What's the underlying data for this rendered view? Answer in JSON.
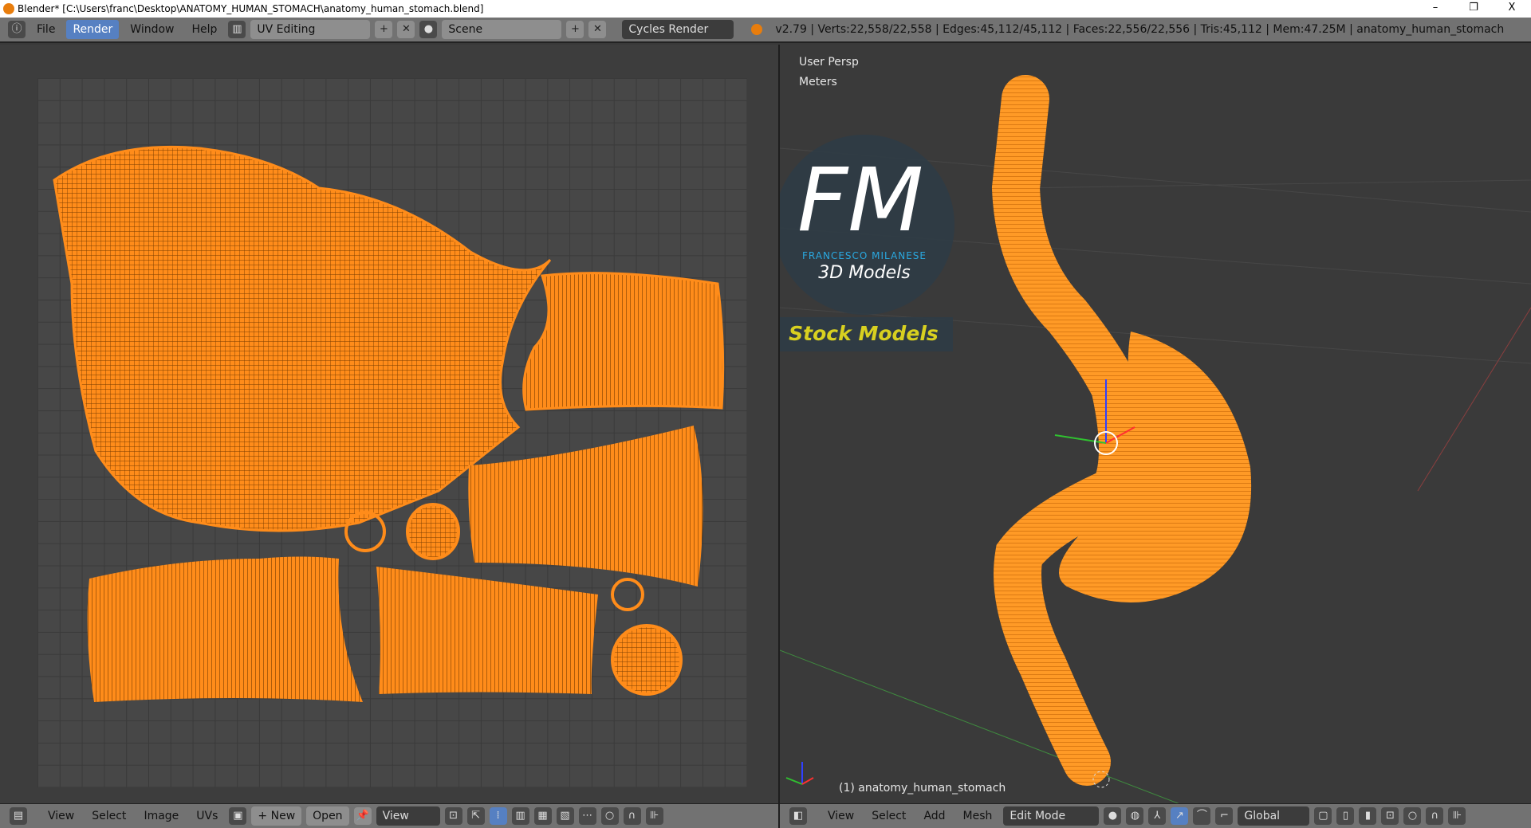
{
  "window": {
    "title": "Blender* [C:\\Users\\franc\\Desktop\\ANATOMY_HUMAN_STOMACH\\anatomy_human_stomach.blend]",
    "minimize": "–",
    "restore": "❐",
    "close": "X"
  },
  "top": {
    "menus": [
      "File",
      "Render",
      "Window",
      "Help"
    ],
    "active_menu": "Render",
    "layout": "UV Editing",
    "scene": "Scene",
    "engine": "Cycles Render",
    "stats": "v2.79 | Verts:22,558/22,558 | Edges:45,112/45,112 | Faces:22,556/22,556 | Tris:45,112 | Mem:47.25M | anatomy_human_stomach"
  },
  "viewport": {
    "view_name": "User Persp",
    "units": "Meters",
    "object_label": "(1) anatomy_human_stomach"
  },
  "logo": {
    "letters": "FM",
    "brand": "FRANCESCO MILANESE",
    "subtitle": "3D Models",
    "banner": "Stock Models"
  },
  "uv_header": {
    "menus": [
      "View",
      "Select",
      "Image",
      "UVs"
    ],
    "new": "New",
    "open": "Open",
    "view": "View"
  },
  "view3d_header": {
    "menus": [
      "View",
      "Select",
      "Add",
      "Mesh"
    ],
    "mode": "Edit Mode",
    "orientation": "Global"
  },
  "colors": {
    "mesh": "#ff8c1a",
    "selected_header": "#5680c2",
    "logo_blue": "#2aa8e0",
    "banner_text": "#d8d020"
  }
}
